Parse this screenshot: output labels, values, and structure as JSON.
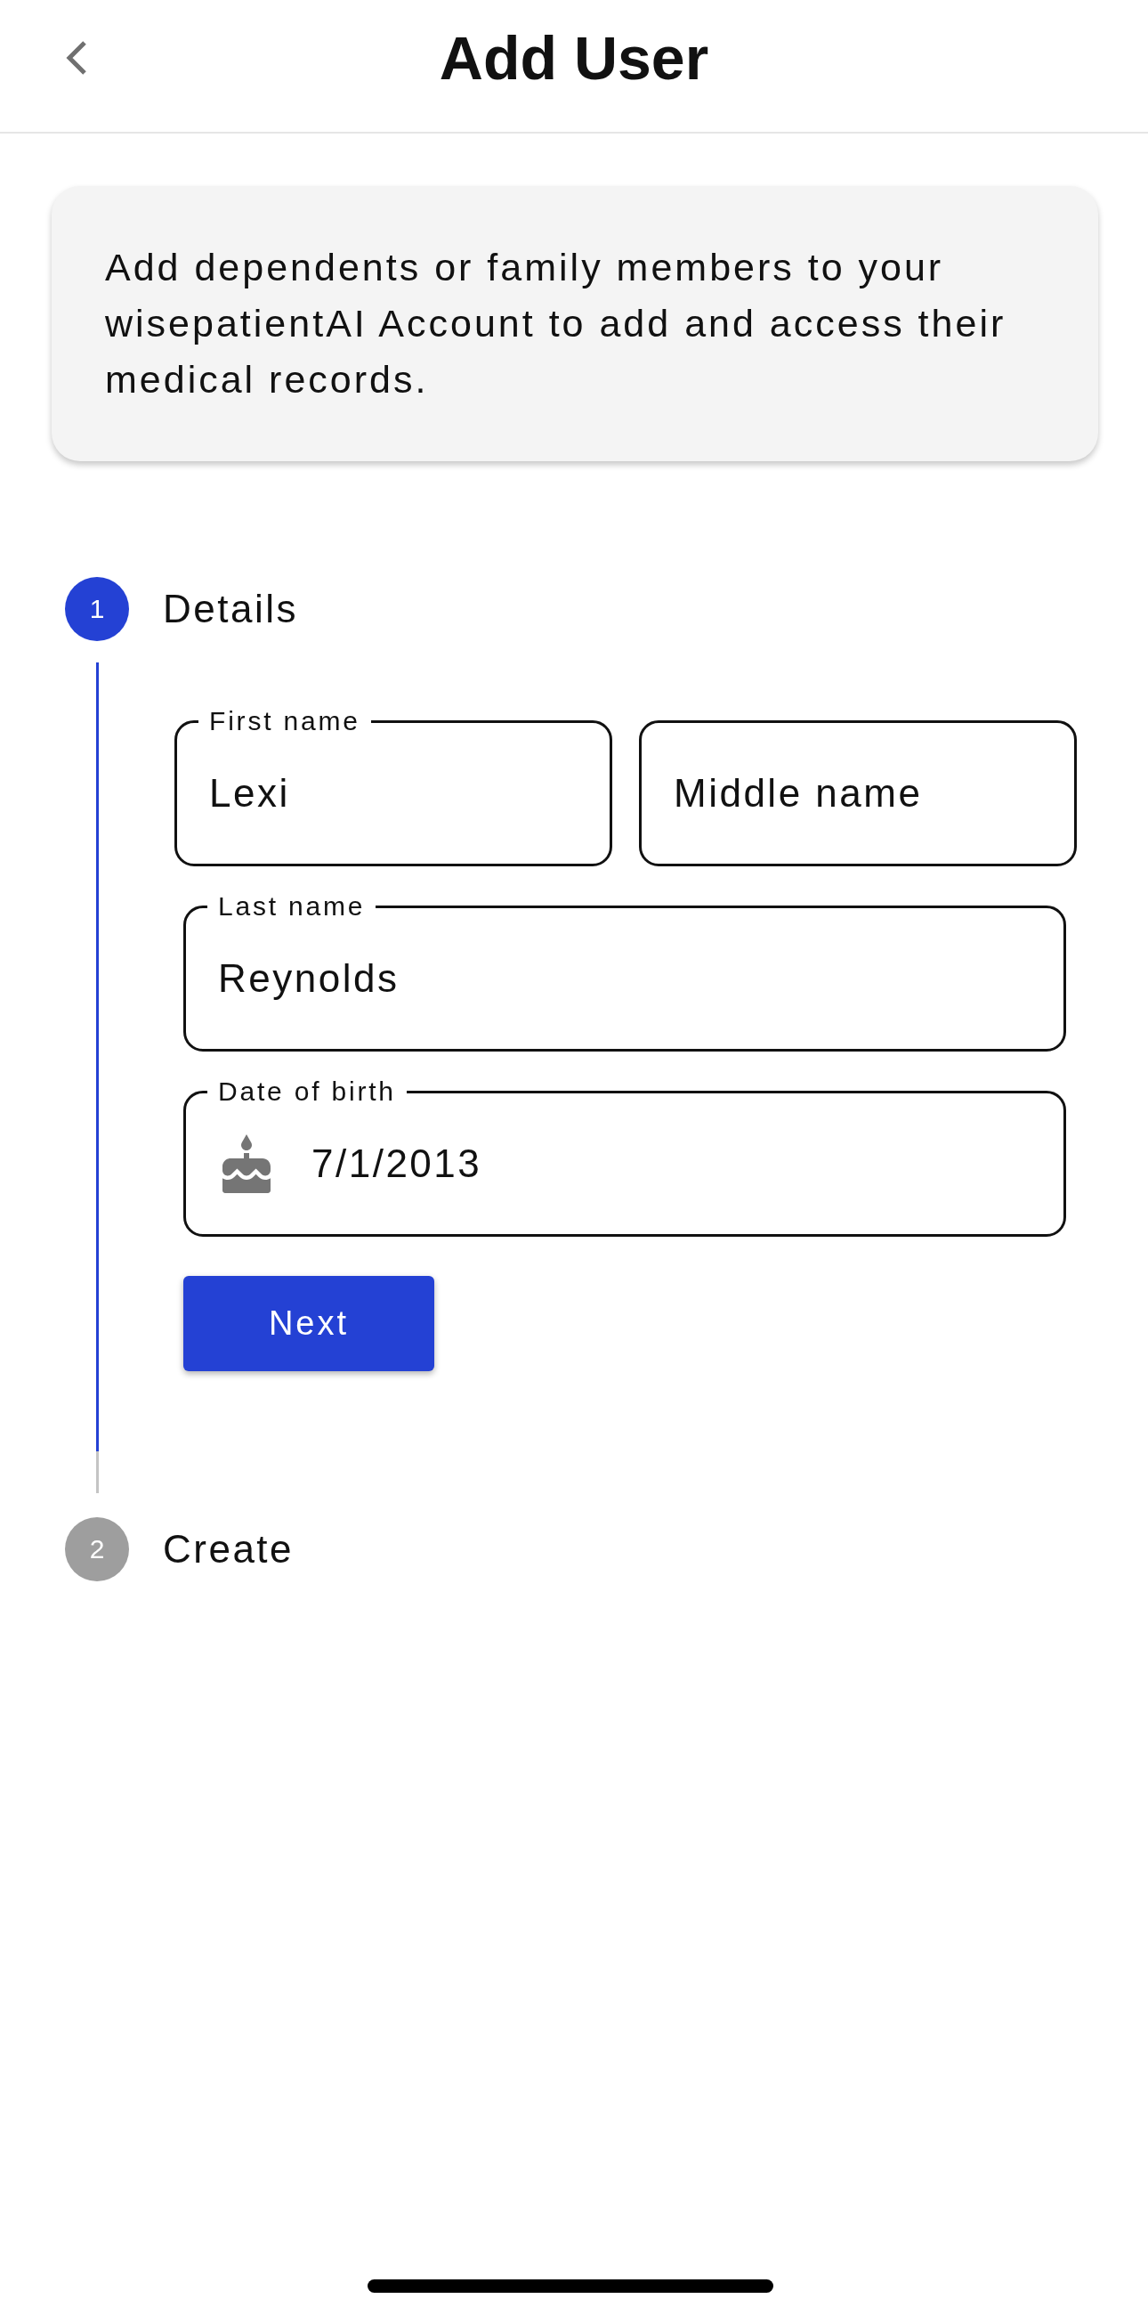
{
  "header": {
    "title": "Add User"
  },
  "info_card": {
    "text": "Add dependents or family members to your wisepatientAI Account to add and access their medical records."
  },
  "stepper": {
    "steps": [
      {
        "number": "1",
        "label": "Details",
        "selected": true,
        "field_rows": [
          [
            {
              "kind": "text",
              "label": "First name",
              "value": "Lexi"
            },
            {
              "kind": "text",
              "placeholder": "Middle name"
            }
          ],
          [
            {
              "kind": "text",
              "label": "Last name",
              "value": "Reynolds"
            }
          ],
          [
            {
              "kind": "date",
              "label": "Date of birth",
              "value": "7/1/2013"
            }
          ]
        ],
        "button": {
          "label": "Next"
        }
      },
      {
        "number": "2",
        "label": "Create",
        "selected": false
      }
    ]
  }
}
